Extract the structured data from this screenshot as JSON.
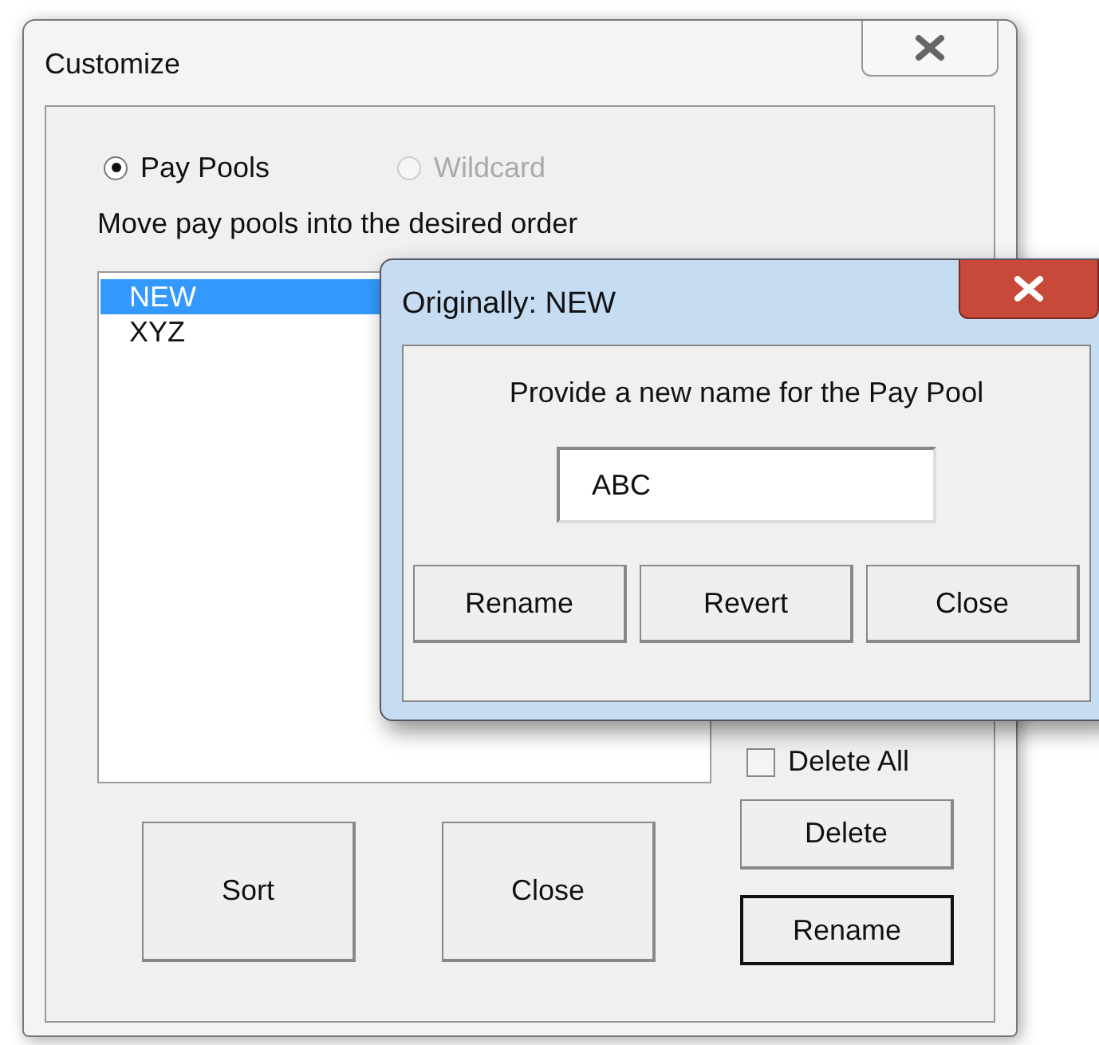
{
  "window": {
    "title": "Customize"
  },
  "mode_options": [
    {
      "label": "Pay Pools",
      "selected": true,
      "disabled": false
    },
    {
      "label": "Wildcard",
      "selected": false,
      "disabled": true
    }
  ],
  "instruction": "Move pay pools into the desired order",
  "pay_pools": [
    {
      "name": "NEW",
      "selected": true
    },
    {
      "name": "XYZ",
      "selected": false
    }
  ],
  "delete_all": {
    "label": "Delete All",
    "checked": false
  },
  "side_buttons": [
    {
      "label": "Delete",
      "default": false
    },
    {
      "label": "Rename",
      "default": true
    }
  ],
  "bottom_buttons": [
    "Sort",
    "Close"
  ],
  "rename_dialog": {
    "title": "Originally: NEW",
    "prompt": "Provide a new name for the Pay Pool",
    "name_field": {
      "value": "ABC"
    },
    "buttons": [
      "Rename",
      "Revert",
      "Close"
    ]
  }
}
